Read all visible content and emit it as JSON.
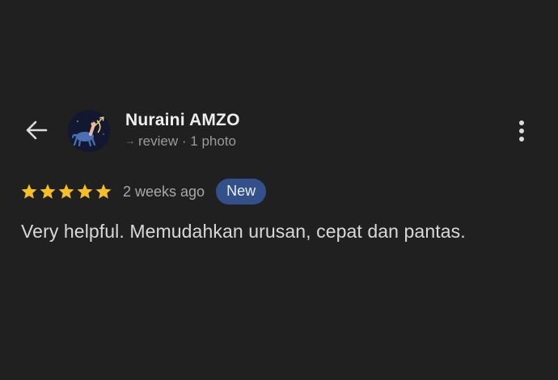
{
  "reviewer": {
    "name": "Nuraini AMZO",
    "review_count": "→",
    "review_label": "review",
    "separator": "·",
    "photo_count": "1 photo"
  },
  "review": {
    "rating": 5,
    "max_rating": 5,
    "time_ago": "2 weeks ago",
    "badge": "New",
    "text": "Very helpful. Memudahkan urusan, cepat dan pantas."
  },
  "icons": {
    "back": "arrow-back-icon",
    "more": "more-vertical-icon",
    "star": "star-icon",
    "avatar": "sagittarius-avatar"
  },
  "colors": {
    "background": "#202020",
    "star": "#f6bf26",
    "badge_bg": "#34508a",
    "text_primary": "#eeeeee",
    "text_secondary": "#9a9a9a"
  }
}
